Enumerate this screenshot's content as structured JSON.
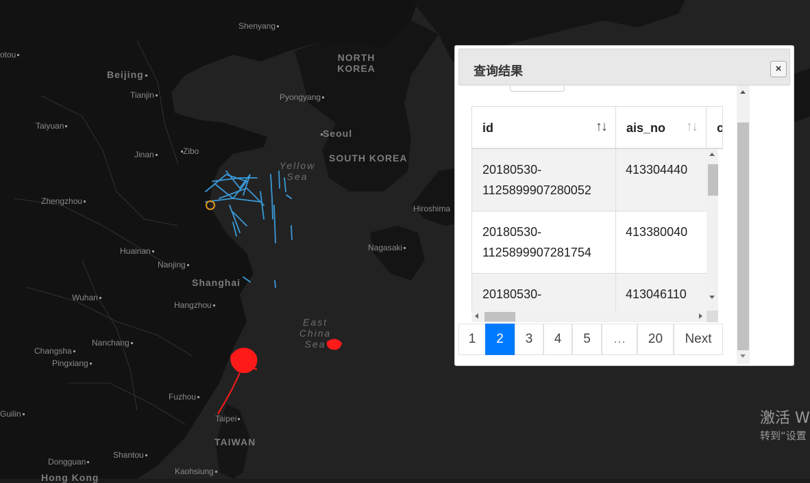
{
  "map": {
    "city_labels": [
      "Shenyang",
      "Beijing",
      "Tianjin",
      "Taiyuan",
      "Jinan",
      "Zibo",
      "Zhengzhou",
      "Huainan",
      "Nanjing",
      "Shanghai",
      "Wuhan",
      "Hangzhou",
      "Nanchang",
      "Changsha",
      "Pingxiang",
      "Fuzhou",
      "Taipei",
      "Guilin",
      "Dongguan",
      "Shantou",
      "Kaohsiung",
      "Hong Kong",
      "Pyongyang",
      "Seoul",
      "Hiroshima",
      "Nagasaki",
      "otou"
    ],
    "country_labels": [
      "NORTH KOREA",
      "SOUTH KOREA",
      "TAIWAN"
    ],
    "sea_labels": [
      "Yellow Sea",
      "East China Sea"
    ],
    "track_colors": {
      "blue": "#3a9ad9",
      "red": "#ff1a1a",
      "marker": "#e0961a"
    }
  },
  "panel": {
    "title": "查询结果",
    "close_icon": "×"
  },
  "table": {
    "columns": [
      {
        "label": "id",
        "sort_icon": "↑↓"
      },
      {
        "label": "ais_no",
        "sort_icon": "↑↓"
      },
      {
        "label": "c"
      }
    ],
    "rows": [
      {
        "id_line1": "20180530-",
        "id_line2": "1125899907280052",
        "ais_no": "413304440"
      },
      {
        "id_line1": "20180530-",
        "id_line2": "1125899907281754",
        "ais_no": "413380040"
      },
      {
        "id_line1": "20180530-",
        "id_line2": "",
        "ais_no": "413046110"
      }
    ]
  },
  "pagination": {
    "pages": [
      "1",
      "2",
      "3",
      "4",
      "5",
      "…",
      "20",
      "Next"
    ],
    "active": "2"
  },
  "windows_activation": {
    "line1": "激活 W",
    "line2": "转到“设置"
  }
}
